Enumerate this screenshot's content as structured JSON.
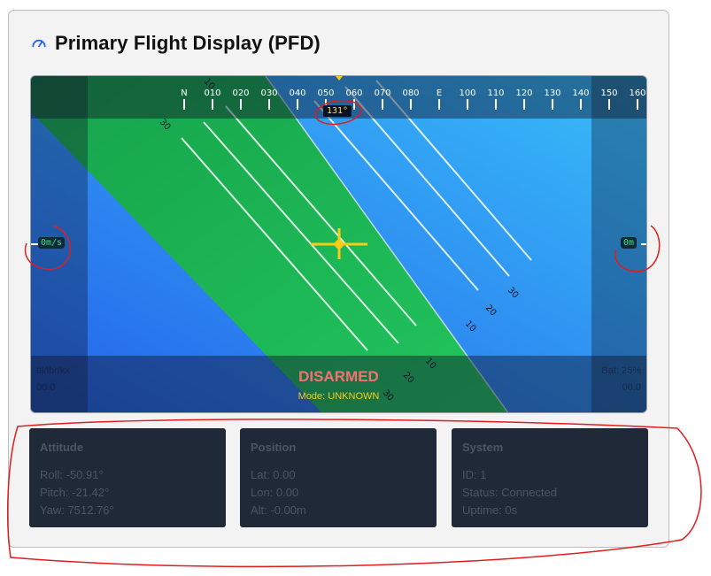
{
  "header": {
    "title": "Primary Flight Display (PFD)",
    "icon": "gauge-icon"
  },
  "pfd": {
    "heading_tape": [
      "N",
      "010",
      "020",
      "030",
      "040",
      "050",
      "060",
      "070",
      "080",
      "E",
      "100",
      "110",
      "120",
      "130",
      "140",
      "150",
      "160"
    ],
    "heading_readout": "131°",
    "speed_readout": "0m/s",
    "altitude_readout": "0m",
    "pitch_labels": [
      "30",
      "20",
      "10",
      "10",
      "20",
      "30",
      "10",
      "30"
    ],
    "status": "DISARMED",
    "mode": "Mode: UNKNOWN",
    "corner_left_top": "ttl/lbr/kx",
    "corner_left_bottom": "00.0",
    "corner_right_top": "Bat: 25%",
    "corner_right_bottom": "00.0",
    "colors": {
      "sky": "#3b82f6",
      "ground": "#22c55e",
      "crosshair": "#facc15"
    }
  },
  "panels": {
    "attitude": {
      "title": "Attitude",
      "roll": "Roll: -50.91°",
      "pitch": "Pitch: -21.42°",
      "yaw": "Yaw: 7512.76°"
    },
    "position": {
      "title": "Position",
      "lat": "Lat: 0.00",
      "lon": "Lon: 0.00",
      "alt": "Alt: -0.00m"
    },
    "system": {
      "title": "System",
      "id": "ID: 1",
      "status": "Status: Connected",
      "uptime": "Uptime: 0s"
    }
  }
}
